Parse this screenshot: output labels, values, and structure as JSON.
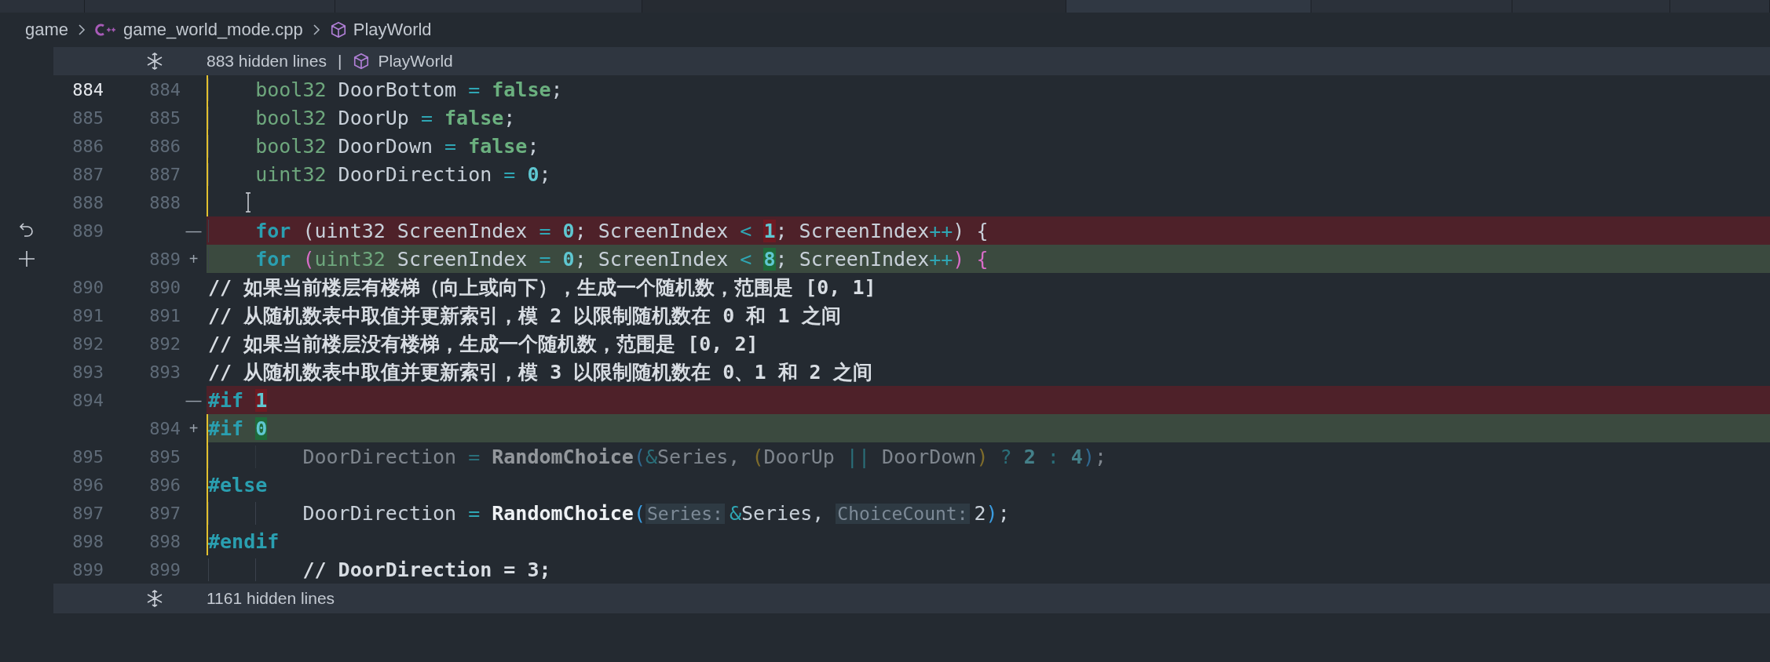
{
  "breadcrumb": {
    "folder": "game",
    "file": "game_world_mode.cpp",
    "symbol": "PlayWorld"
  },
  "top_fold": {
    "label": "883 hidden lines",
    "separator": "|",
    "symbol": "PlayWorld"
  },
  "lines": [
    {
      "old": "884",
      "new": "884",
      "kind": "same",
      "current": true,
      "edited": true,
      "inactive": false,
      "tokens": [
        {
          "kind": "type",
          "text": "    bool32"
        },
        {
          "kind": "id",
          "text": " DoorBottom "
        },
        {
          "kind": "op",
          "text": "= "
        },
        {
          "kind": "bool",
          "text": "false"
        },
        {
          "kind": "id",
          "text": ";"
        }
      ]
    },
    {
      "old": "885",
      "new": "885",
      "kind": "same",
      "current": false,
      "edited": true,
      "inactive": false,
      "tokens": [
        {
          "kind": "type",
          "text": "    bool32"
        },
        {
          "kind": "id",
          "text": " DoorUp "
        },
        {
          "kind": "op",
          "text": "= "
        },
        {
          "kind": "bool",
          "text": "false"
        },
        {
          "kind": "id",
          "text": ";"
        }
      ]
    },
    {
      "old": "886",
      "new": "886",
      "kind": "same",
      "current": false,
      "edited": true,
      "inactive": false,
      "tokens": [
        {
          "kind": "type",
          "text": "    bool32"
        },
        {
          "kind": "id",
          "text": " DoorDown "
        },
        {
          "kind": "op",
          "text": "= "
        },
        {
          "kind": "bool",
          "text": "false"
        },
        {
          "kind": "id",
          "text": ";"
        }
      ]
    },
    {
      "old": "887",
      "new": "887",
      "kind": "same",
      "current": false,
      "edited": true,
      "inactive": false,
      "tokens": [
        {
          "kind": "type",
          "text": "    uint32"
        },
        {
          "kind": "id",
          "text": " DoorDirection "
        },
        {
          "kind": "op",
          "text": "= "
        },
        {
          "kind": "num",
          "text": "0"
        },
        {
          "kind": "id",
          "text": ";"
        }
      ]
    },
    {
      "old": "888",
      "new": "888",
      "kind": "same",
      "current": false,
      "edited": true
    },
    {
      "old": "889",
      "marker": "—",
      "kind": "deleted",
      "current": false,
      "edited": false,
      "inactive": false,
      "tokens": [
        {
          "kind": "kw",
          "text": "    for"
        },
        {
          "kind": "id",
          "text": " (uint32 ScreenIndex "
        },
        {
          "kind": "op",
          "text": "= "
        },
        {
          "kind": "num",
          "text": "0"
        },
        {
          "kind": "id",
          "text": "; ScreenIndex "
        },
        {
          "kind": "op",
          "text": "< "
        },
        {
          "kind": "changed",
          "text": "1"
        },
        {
          "kind": "id",
          "text": "; ScreenIndex"
        },
        {
          "kind": "op",
          "text": "++"
        },
        {
          "kind": "id",
          "text": ") {"
        }
      ]
    },
    {
      "new": "889",
      "marker": "+",
      "kind": "inserted",
      "edited": false,
      "inactive": false,
      "tokens": [
        {
          "kind": "kw",
          "text": "    for"
        },
        {
          "kind": "bracket",
          "text": " ("
        },
        {
          "kind": "type",
          "text": "uint32"
        },
        {
          "kind": "id",
          "text": " ScreenIndex "
        },
        {
          "kind": "op",
          "text": "= "
        },
        {
          "kind": "num",
          "text": "0"
        },
        {
          "kind": "id",
          "text": "; ScreenIndex "
        },
        {
          "kind": "op",
          "text": "< "
        },
        {
          "kind": "changed",
          "text": "8"
        },
        {
          "kind": "id",
          "text": "; ScreenIndex"
        },
        {
          "kind": "op",
          "text": "++"
        },
        {
          "kind": "bracket",
          "text": ") {"
        }
      ]
    },
    {
      "old": "890",
      "new": "890",
      "kind": "same",
      "current": false,
      "edited": false,
      "inactive": false,
      "tokens": [
        {
          "kind": "comment",
          "text": "// 如果当前楼层有楼梯（向上或向下），生成一个随机数，范围是 [0, 1]"
        }
      ]
    },
    {
      "old": "891",
      "new": "891",
      "kind": "same",
      "current": false,
      "edited": false,
      "inactive": false,
      "tokens": [
        {
          "kind": "comment",
          "text": "// 从随机数表中取值并更新索引，模 2 以限制随机数在 0 和 1 之间"
        }
      ]
    },
    {
      "old": "892",
      "new": "892",
      "kind": "same",
      "current": false,
      "edited": false,
      "inactive": false,
      "tokens": [
        {
          "kind": "comment",
          "text": "// 如果当前楼层没有楼梯，生成一个随机数，范围是 [0, 2]"
        }
      ]
    },
    {
      "old": "893",
      "new": "893",
      "kind": "same",
      "current": false,
      "edited": false,
      "inactive": false,
      "tokens": [
        {
          "kind": "comment",
          "text": "// 从随机数表中取值并更新索引，模 3 以限制随机数在 0、1 和 2 之间"
        }
      ]
    },
    {
      "old": "894",
      "marker": "—",
      "kind": "deleted",
      "current": false,
      "edited": false,
      "inactive": false,
      "tokens": [
        {
          "kind": "pre",
          "text": "#if "
        },
        {
          "kind": "changed",
          "text": "1"
        }
      ]
    },
    {
      "new": "894",
      "marker": "+",
      "kind": "inserted",
      "edited": true,
      "inactive": false,
      "tokens": [
        {
          "kind": "pre",
          "text": "#if "
        },
        {
          "kind": "changed",
          "text": "0"
        }
      ]
    },
    {
      "old": "895",
      "new": "895",
      "kind": "same",
      "current": false,
      "edited": true,
      "inactive": true,
      "tokens": [
        {
          "kind": "id",
          "text": "        DoorDirection "
        },
        {
          "kind": "op",
          "text": "= "
        },
        {
          "kind": "fn",
          "text": "RandomChoice"
        },
        {
          "kind": "paren",
          "text": "("
        },
        {
          "kind": "op",
          "text": "&"
        },
        {
          "kind": "id",
          "text": "Series, "
        },
        {
          "kind": "paren2",
          "text": "("
        },
        {
          "kind": "id",
          "text": "DoorUp "
        },
        {
          "kind": "op",
          "text": "||"
        },
        {
          "kind": "id",
          "text": " DoorDown"
        },
        {
          "kind": "paren2",
          "text": ")"
        },
        {
          "kind": "op",
          "text": " ? "
        },
        {
          "kind": "num",
          "text": "2"
        },
        {
          "kind": "op",
          "text": " : "
        },
        {
          "kind": "num",
          "text": "4"
        },
        {
          "kind": "paren",
          "text": ")"
        },
        {
          "kind": "id",
          "text": ";"
        }
      ]
    },
    {
      "old": "896",
      "new": "896",
      "kind": "same",
      "current": false,
      "edited": true,
      "inactive": false,
      "tokens": [
        {
          "kind": "pre",
          "text": "#else"
        }
      ]
    },
    {
      "old": "897",
      "new": "897",
      "kind": "same",
      "current": false,
      "edited": true,
      "inactive": false,
      "tokens": [
        {
          "kind": "id",
          "text": "        DoorDirection "
        },
        {
          "kind": "op",
          "text": "= "
        },
        {
          "kind": "fn",
          "text": "RandomChoice"
        },
        {
          "kind": "paren",
          "text": "("
        },
        {
          "kind": "hint",
          "text": "Series:"
        },
        {
          "kind": "op",
          "text": "&"
        },
        {
          "kind": "id",
          "text": "Series, "
        },
        {
          "kind": "hint",
          "text": "ChoiceCount:"
        },
        {
          "kind": "id",
          "text": "2"
        },
        {
          "kind": "paren",
          "text": ")"
        },
        {
          "kind": "id",
          "text": ";"
        }
      ]
    },
    {
      "old": "898",
      "new": "898",
      "kind": "same",
      "current": false,
      "edited": true,
      "inactive": false,
      "tokens": [
        {
          "kind": "pre",
          "text": "#endif"
        }
      ]
    },
    {
      "old": "899",
      "new": "899",
      "kind": "same",
      "current": false,
      "edited": false,
      "inactive": false,
      "tokens": [
        {
          "kind": "comment",
          "text": "        // DoorDirection = 3;"
        }
      ]
    }
  ],
  "bottom_fold": {
    "label": "1161 hidden lines"
  }
}
